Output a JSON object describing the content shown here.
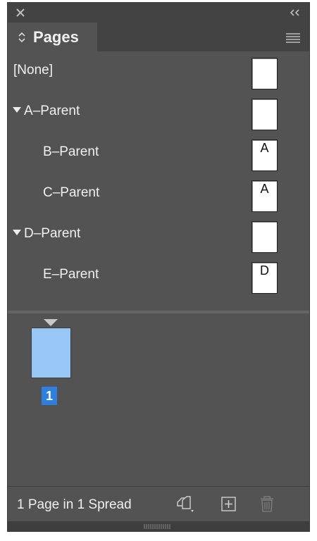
{
  "panel": {
    "tab_label": "Pages",
    "icons": {
      "close": "close-icon",
      "collapse": "double-chevron-left-icon",
      "tab_arrows": "up-down-arrows-icon",
      "menu": "hamburger-menu-icon"
    }
  },
  "parents": [
    {
      "name": "[None]",
      "letter": "",
      "expanded": null,
      "indent": 0
    },
    {
      "name": "A–Parent",
      "letter": "",
      "expanded": true,
      "indent": 0
    },
    {
      "name": "B–Parent",
      "letter": "A",
      "expanded": null,
      "indent": 1
    },
    {
      "name": "C–Parent",
      "letter": "A",
      "expanded": null,
      "indent": 1
    },
    {
      "name": "D–Parent",
      "letter": "",
      "expanded": true,
      "indent": 0
    },
    {
      "name": "E–Parent",
      "letter": "D",
      "expanded": null,
      "indent": 1
    }
  ],
  "pages": [
    {
      "number": "1",
      "selected": true
    }
  ],
  "footer": {
    "status": "1 Page in 1 Spread",
    "icons": [
      "edit-page-size-icon",
      "new-page-icon",
      "trash-icon"
    ]
  },
  "colors": {
    "panel_bg": "#535353",
    "header_bg": "#434343",
    "page_thumb": "#98c6f6",
    "selected_number_bg": "#2d7fe0"
  }
}
